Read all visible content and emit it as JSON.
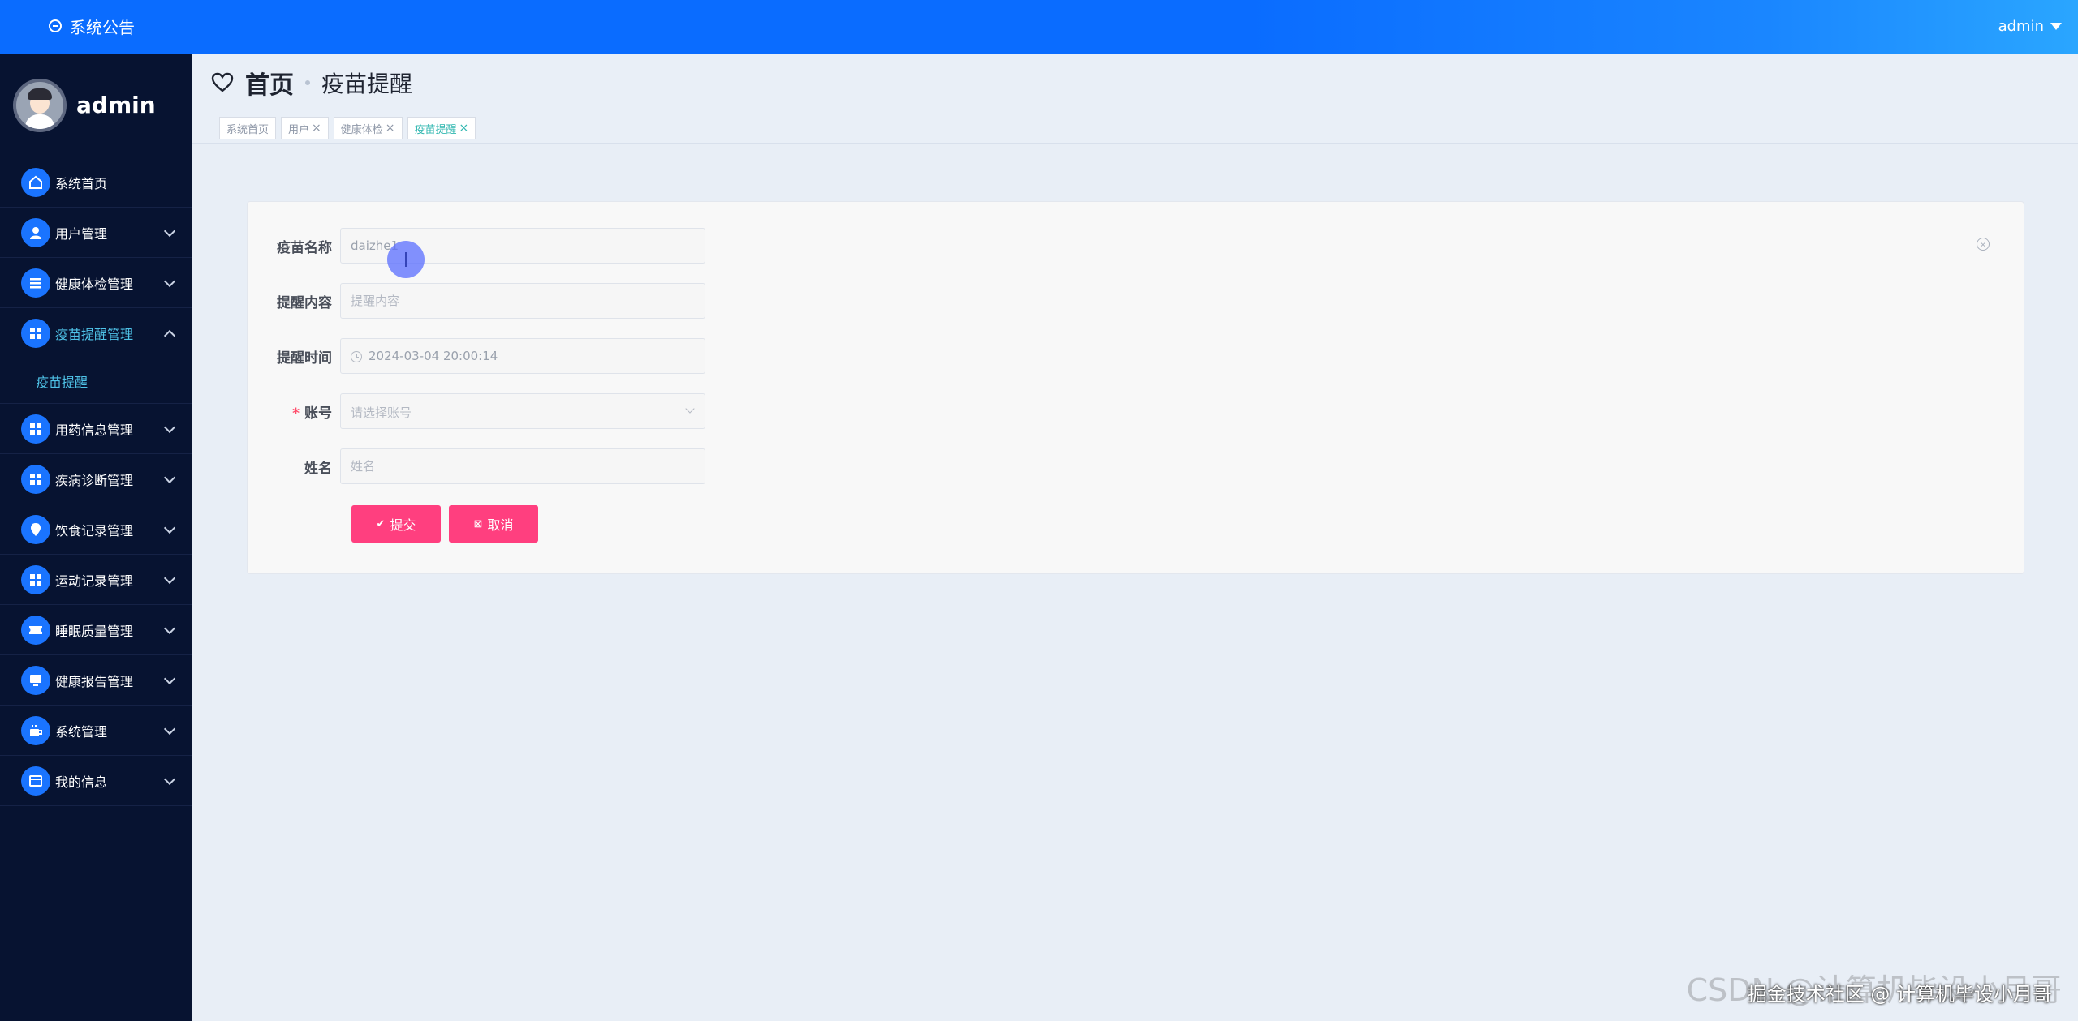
{
  "topbar": {
    "announcement": "系统公告",
    "user": "admin"
  },
  "sidebar": {
    "profile_name": "admin",
    "items": [
      {
        "label": "系统首页",
        "icon": "home-icon",
        "expanded": false,
        "has_chevron": false
      },
      {
        "label": "用户管理",
        "icon": "user-icon",
        "expanded": false,
        "has_chevron": true
      },
      {
        "label": "健康体检管理",
        "icon": "list-icon",
        "expanded": false,
        "has_chevron": true
      },
      {
        "label": "疫苗提醒管理",
        "icon": "grid-icon",
        "expanded": true,
        "has_chevron": true,
        "active": true
      },
      {
        "label": "用药信息管理",
        "icon": "grid-icon",
        "expanded": false,
        "has_chevron": true
      },
      {
        "label": "疾病诊断管理",
        "icon": "grid-icon",
        "expanded": false,
        "has_chevron": true
      },
      {
        "label": "饮食记录管理",
        "icon": "location-icon",
        "expanded": false,
        "has_chevron": true
      },
      {
        "label": "运动记录管理",
        "icon": "grid-icon",
        "expanded": false,
        "has_chevron": true
      },
      {
        "label": "睡眠质量管理",
        "icon": "ticket-icon",
        "expanded": false,
        "has_chevron": true
      },
      {
        "label": "健康报告管理",
        "icon": "monitor-icon",
        "expanded": false,
        "has_chevron": true
      },
      {
        "label": "系统管理",
        "icon": "cup-icon",
        "expanded": false,
        "has_chevron": true
      },
      {
        "label": "我的信息",
        "icon": "card-icon",
        "expanded": false,
        "has_chevron": true
      }
    ],
    "sub_item": "疫苗提醒"
  },
  "breadcrumb": {
    "home": "首页",
    "current": "疫苗提醒"
  },
  "tags": [
    {
      "label": "系统首页",
      "closable": false,
      "active": false
    },
    {
      "label": "用户",
      "closable": true,
      "active": false
    },
    {
      "label": "健康体检",
      "closable": true,
      "active": false
    },
    {
      "label": "疫苗提醒",
      "closable": true,
      "active": true
    }
  ],
  "form": {
    "vaccine_name_label": "疫苗名称",
    "vaccine_name_value": "daizhe1",
    "reminder_content_label": "提醒内容",
    "reminder_content_placeholder": "提醒内容",
    "reminder_time_label": "提醒时间",
    "reminder_time_value": "2024-03-04 20:00:14",
    "account_required_mark": "*",
    "account_label": "账号",
    "account_placeholder": "请选择账号",
    "name_label": "姓名",
    "name_placeholder": "姓名",
    "submit_label": "提交",
    "cancel_label": "取消"
  },
  "watermark": "CSDN @计算机毕设小月哥",
  "watermark_overlay": "掘金技术社区 @ 计算机毕设小月哥",
  "colors": {
    "topbar": "#0a6cff",
    "sidebar": "#071331",
    "accent_teal": "#4fc3e8",
    "button_pink": "#ff3f7f"
  }
}
